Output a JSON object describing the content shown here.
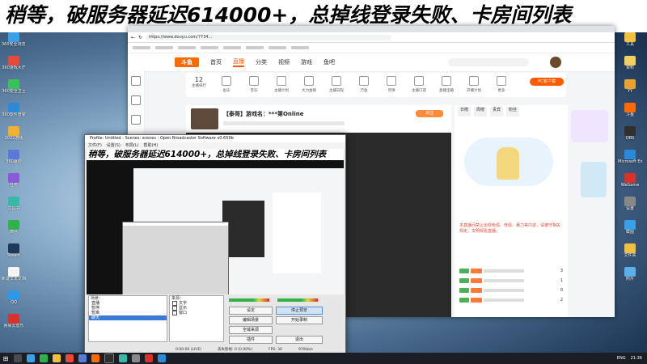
{
  "banner": {
    "text": "稍等，破服务器延迟614000+，总掉线登录失败、卡房间列表"
  },
  "desktop": {
    "left_icons": [
      "360安全浏览器",
      "360游戏大厅",
      "360安全卫士",
      "360软件管家",
      "2022游戏",
      "360驱动",
      "任务",
      "工具书",
      "微信",
      "Steam",
      "新建文本文档",
      "QQ",
      "网易云音乐"
    ],
    "right_icons": [
      "工具",
      "资料",
      "YY",
      "斗鱼",
      "OBS",
      "Microsoft Edge",
      "WeGame",
      "设置",
      "截图",
      "文件夹",
      "照片"
    ]
  },
  "browser": {
    "url": "https://www.douyu.com/7734...",
    "nav": {
      "logo": "斗鱼",
      "items": [
        "首页",
        "直播",
        "分类",
        "视频",
        "游戏",
        "鱼吧"
      ],
      "active": "直播"
    },
    "categories": [
      {
        "label": "主播排行",
        "value": "12"
      },
      {
        "label": "鱼乐"
      },
      {
        "label": "音乐"
      },
      {
        "label": "主播计划"
      },
      {
        "label": "大力金刚"
      },
      {
        "label": "主播日程"
      },
      {
        "label": "万鱼"
      },
      {
        "label": "月饼"
      },
      {
        "label": "主播口袋"
      },
      {
        "label": "直播宝箱"
      },
      {
        "label": "开播计划"
      },
      {
        "label": "更多"
      }
    ],
    "pc_button": "PC客户端",
    "stream": {
      "title": "【泰哥】游戏名：***第Online",
      "follow": "关注"
    },
    "right_panel": {
      "tabs": [
        "日榜",
        "周榜",
        "贵宾",
        "粉丝"
      ],
      "notice": "本直播间禁止出现色情、低俗、暴力等内容，请遵守相关规定，文明观看直播。",
      "rows": [
        {
          "value": "3"
        },
        {
          "value": "1"
        },
        {
          "value": "0"
        },
        {
          "value": "2"
        }
      ]
    }
  },
  "obs": {
    "title": "Profile: Untitled - Scenes: scenes - Open Broadcaster Software v0.659b",
    "menu": [
      "文件(F)",
      "设置(S)",
      "布局(L)",
      "帮助(H)"
    ],
    "preview_banner": "稍等，破服务器延迟614000+，总掉线登录失败、卡房间列表",
    "scenes_title": "场景：",
    "scenes": [
      "直播",
      "暂停",
      "暂离",
      "聊天"
    ],
    "scene_selected": "聊天",
    "sources_title": "来源：",
    "sources": [
      "文字",
      "显示",
      "窗口"
    ],
    "buttons": {
      "settings": "设定",
      "stop_preview": "停止预览",
      "edit_scene": "编辑场景",
      "start_record": "开始录制",
      "global_sources": "全域来源",
      "plugins": "插件",
      "exit": "退出"
    },
    "status": {
      "time": "0:00:00 (LIVE)",
      "dropped": "丢失影格: 0 (0.00%)",
      "fps": "FPS: 30",
      "bitrate": "970kb/s"
    }
  },
  "taskbar": {
    "ime": "ENG",
    "time": "21:36"
  }
}
